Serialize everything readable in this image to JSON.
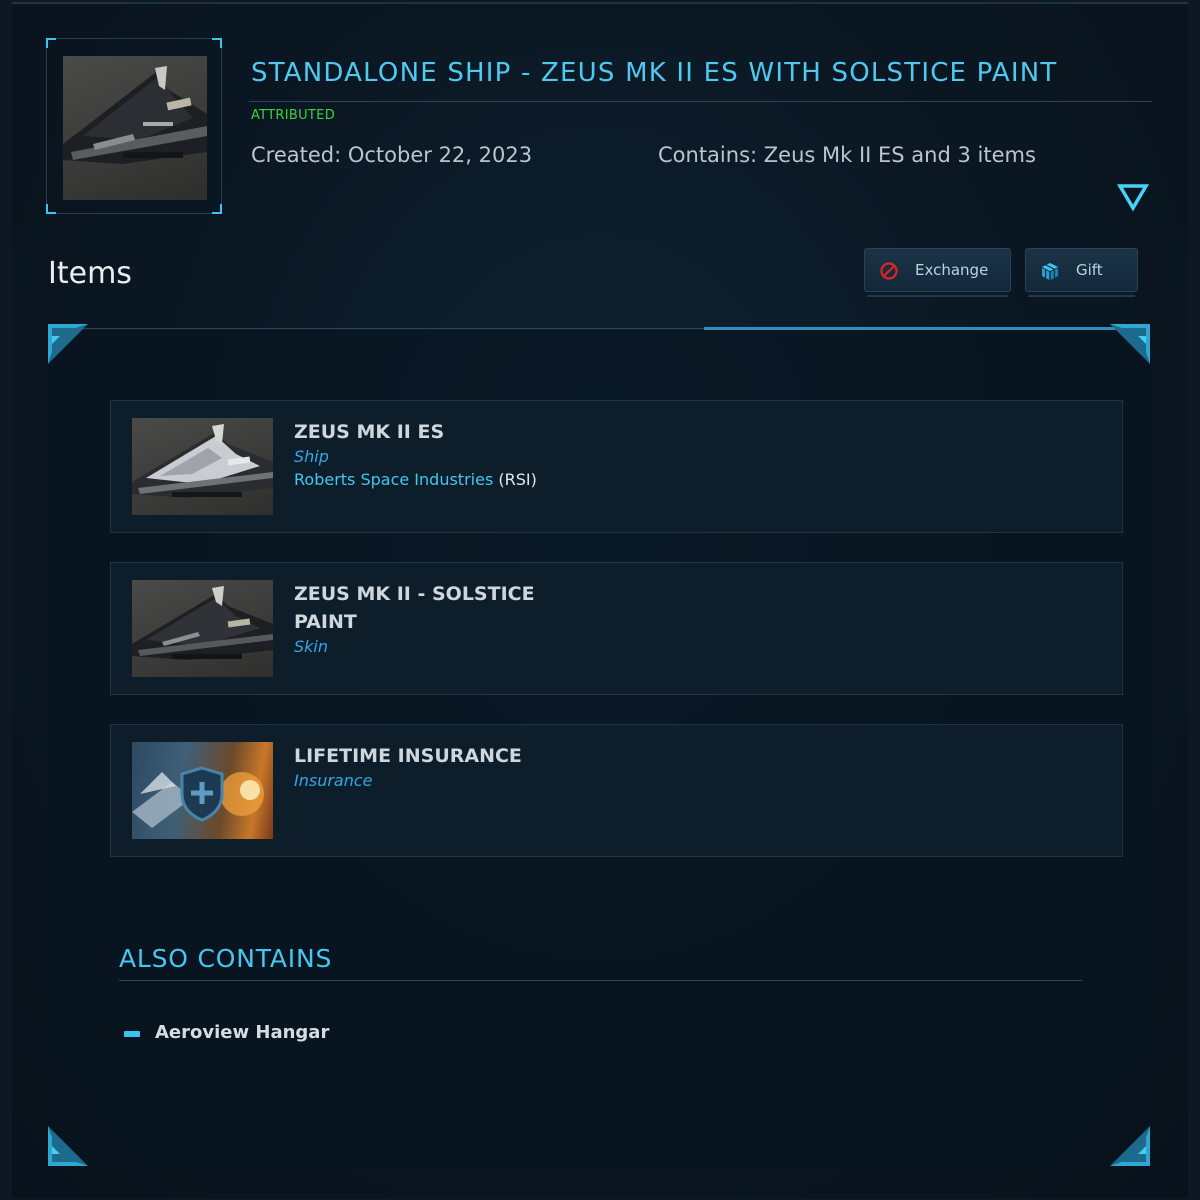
{
  "pledge": {
    "title": "STANDALONE SHIP - ZEUS MK II ES WITH SOLSTICE PAINT",
    "status": "ATTRIBUTED",
    "created_label": "Created: ",
    "created_value": "October 22, 2023",
    "contains_label": "Contains: ",
    "contains_value": "Zeus Mk II ES and 3 items",
    "thumbnail_icon": "ship-thumbnail"
  },
  "items_section": {
    "heading": "Items",
    "actions": {
      "exchange_label": "Exchange",
      "exchange_icon": "prohibited-icon",
      "gift_label": "Gift",
      "gift_icon": "gift-box-icon"
    }
  },
  "items": [
    {
      "name": "ZEUS MK II ES",
      "type": "Ship",
      "manufacturer_name": "Roberts Space Industries ",
      "manufacturer_code": "(RSI)"
    },
    {
      "name": "ZEUS MK II - SOLSTICE PAINT",
      "type": "Skin"
    },
    {
      "name": "LIFETIME INSURANCE",
      "type": "Insurance"
    }
  ],
  "also_contains": {
    "heading": "ALSO CONTAINS",
    "items": [
      "Aeroview Hangar"
    ]
  },
  "colors": {
    "accent": "#4fc9ef",
    "status_green": "#38d43a",
    "type_blue": "#34a6e6",
    "background": "#0d1823"
  }
}
